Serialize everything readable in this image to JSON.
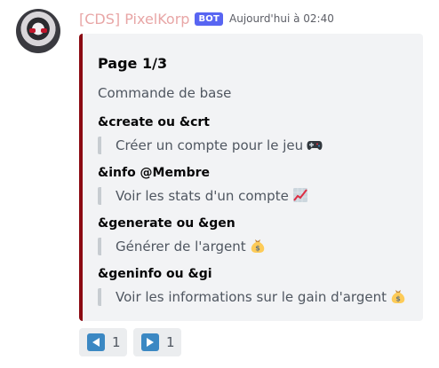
{
  "message": {
    "username": "[CDS] PixelKorp",
    "bot_tag": "BOT",
    "timestamp": "Aujourd'hui à 02:40"
  },
  "embed": {
    "accent_color": "#8b0a12",
    "title": "Page 1/3",
    "description": "Commande de base",
    "fields": [
      {
        "name": "&create ou &crt",
        "value": "Créer un compte pour le jeu",
        "icon": "video-game-controller-icon"
      },
      {
        "name": "&info @Membre",
        "value": "Voir les stats d'un compte",
        "icon": "chart-increasing-icon"
      },
      {
        "name": "&generate ou &gen",
        "value": "Générer de l'argent",
        "icon": "money-bag-icon"
      },
      {
        "name": "&geninfo ou &gi",
        "value": "Voir les informations sur le gain d'argent",
        "icon": "money-bag-icon"
      }
    ]
  },
  "reactions": [
    {
      "icon": "arrow-backward-icon",
      "count": "1"
    },
    {
      "icon": "arrow-forward-icon",
      "count": "1"
    }
  ]
}
